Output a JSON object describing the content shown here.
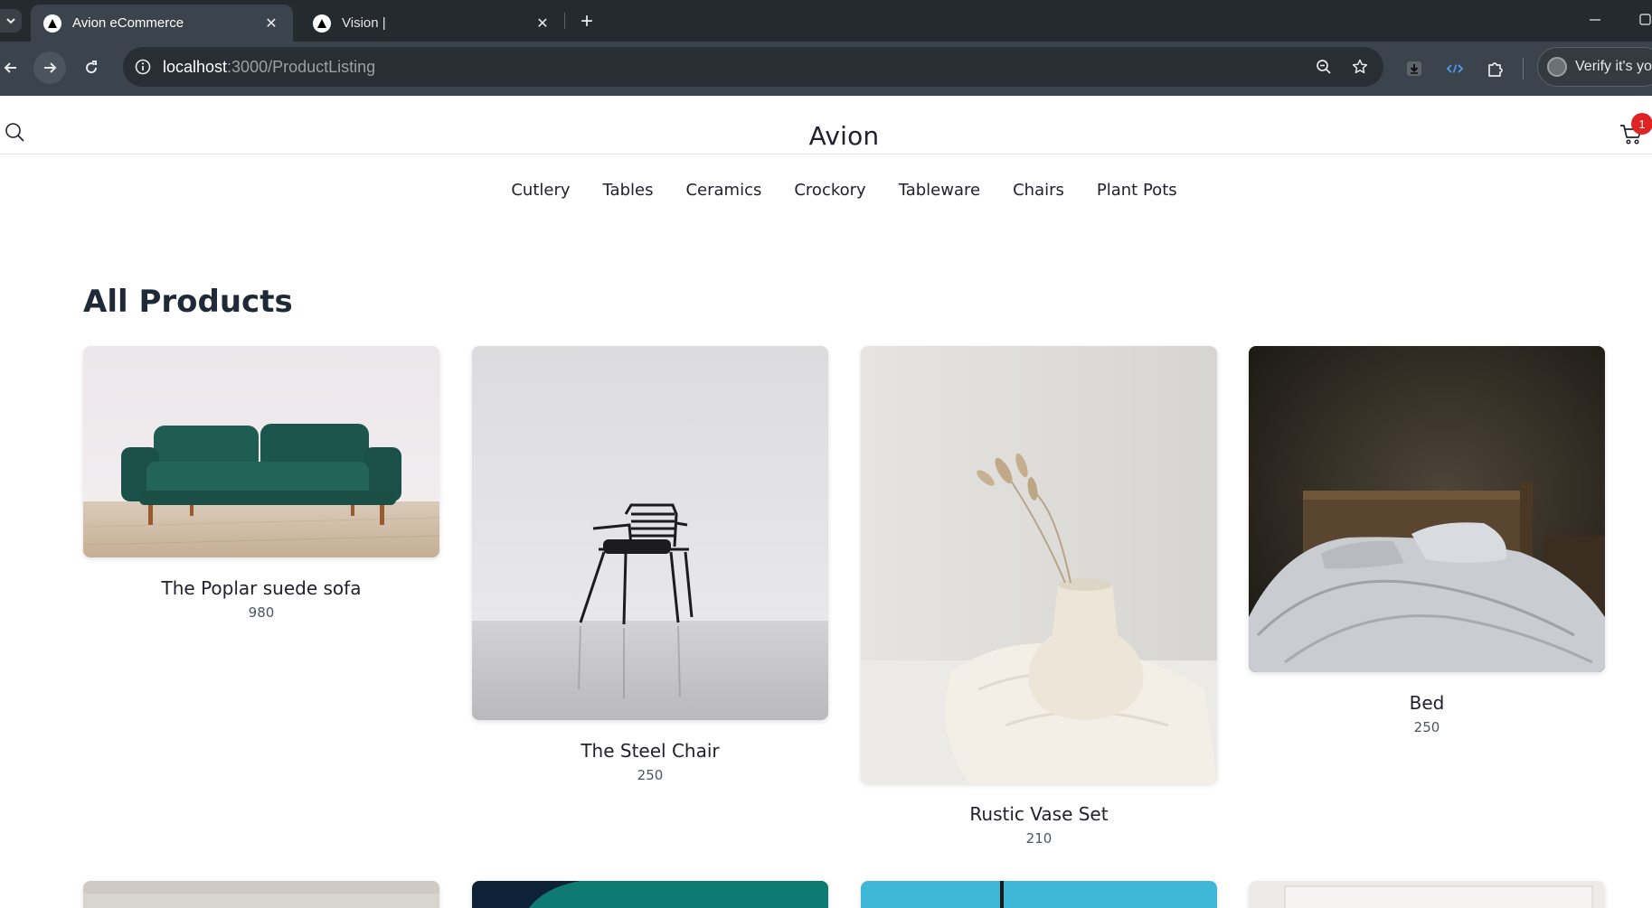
{
  "browser": {
    "tabs": [
      {
        "title": "Avion eCommerce",
        "active": true
      },
      {
        "title": "Vision |",
        "active": false
      }
    ],
    "url_host": "localhost",
    "url_path": ":3000/ProductListing",
    "profile_label": "Verify it's you"
  },
  "site": {
    "brand": "Avion",
    "cart_count": "1",
    "categories": [
      "Cutlery",
      "Tables",
      "Ceramics",
      "Crockory",
      "Tableware",
      "Chairs",
      "Plant Pots"
    ],
    "heading": "All Products"
  },
  "products": [
    {
      "name": "The Poplar suede sofa",
      "price": "980"
    },
    {
      "name": "The Steel Chair",
      "price": "250"
    },
    {
      "name": "Rustic Vase Set",
      "price": "210"
    },
    {
      "name": "Bed",
      "price": "250"
    }
  ],
  "colors": {
    "badge": "#e02424",
    "sofa": "#1f5c52",
    "toolbar": "#3b444c"
  }
}
